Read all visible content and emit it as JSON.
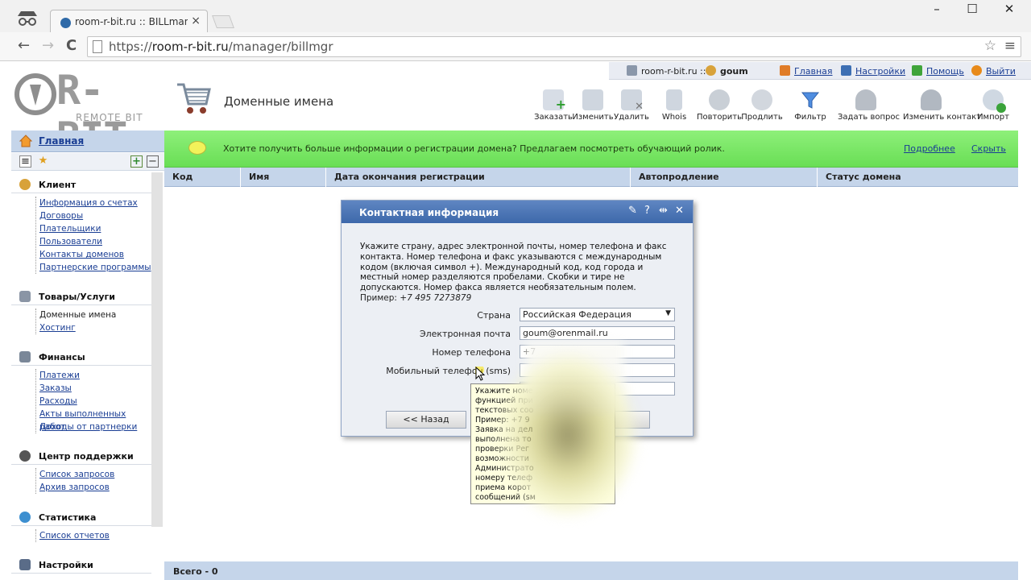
{
  "browser": {
    "tab_title": "room-r-bit.ru :: BILLmanag",
    "tab_close": "×",
    "url_prefix": "https://",
    "url_host": "room-r-bit.ru",
    "url_path": "/manager/billmgr",
    "window_minimize": "–",
    "window_maximize": "☐",
    "window_close": "✕",
    "back": "←",
    "forward": "→",
    "reload": "C",
    "star": "☆",
    "menu": "≡"
  },
  "header": {
    "logo_text": "R-BIT",
    "logo_sub": "REMOTE BIT",
    "page_title": "Доменные имена",
    "userbar": {
      "site": "room-r-bit.ru ::",
      "user": "goum",
      "home": "Главная",
      "settings": "Настройки",
      "help": "Помощь",
      "logout": "Выйти"
    },
    "toolbar": [
      {
        "label": "Заказать",
        "icon": "add-icon"
      },
      {
        "label": "Изменить",
        "icon": "edit-icon"
      },
      {
        "label": "Удалить",
        "icon": "delete-icon"
      },
      {
        "label": "Whois",
        "icon": "whois-icon"
      },
      {
        "label": "Повторить",
        "icon": "repeat-icon"
      },
      {
        "label": "Продлить",
        "icon": "renew-icon"
      },
      {
        "label": "Фильтр",
        "icon": "filter-icon"
      },
      {
        "label": "Задать вопрос",
        "icon": "question-icon"
      },
      {
        "label": "Изменить контакт",
        "icon": "contact-icon"
      },
      {
        "label": "Импорт",
        "icon": "import-icon"
      }
    ]
  },
  "sidebar": {
    "home": "Главная",
    "tool_plus": "+",
    "tool_minus": "−",
    "sections": [
      {
        "title": "Клиент",
        "items": [
          "Информация о счетах",
          "Договоры",
          "Плательщики",
          "Пользователи",
          "Контакты доменов",
          "Партнерские программы"
        ]
      },
      {
        "title": "Товары/Услуги",
        "items": [
          "Доменные имена",
          "Хостинг"
        ]
      },
      {
        "title": "Финансы",
        "items": [
          "Платежи",
          "Заказы",
          "Расходы",
          "Акты выполненных работ",
          "Доходы от партнерки"
        ]
      },
      {
        "title": "Центр поддержки",
        "items": [
          "Список запросов",
          "Архив запросов"
        ]
      },
      {
        "title": "Статистика",
        "items": [
          "Список отчетов"
        ]
      },
      {
        "title": "Настройки",
        "items": []
      }
    ]
  },
  "banner": {
    "message": "Хотите получить больше информации о регистрации домена? Предлагаем посмотреть обучающий ролик.",
    "more": "Подробнее",
    "hide": "Скрыть"
  },
  "table": {
    "columns": [
      "Код",
      "Имя",
      "Дата окончания регистрации",
      "Автопродление",
      "Статус домена"
    ],
    "footer": "Всего - 0"
  },
  "dialog": {
    "title": "Контактная информация",
    "intro": "Укажите страну, адрес электронной почты, номер телефона и факс контакта. Номер телефона и факс указываются с международным кодом (включая символ +). Международный код, код города и местный номер разделяются пробелами. Скобки и тире не допускаются. Номер факса является необязательным полем.",
    "example_label": "Пример:",
    "example_value": "+7 495 7273879",
    "fields": {
      "country_label": "Страна",
      "country_value": "Российская Федерация",
      "email_label": "Электронная почта",
      "email_value": "goum@orenmail.ru",
      "phone_label": "Номер телефона",
      "phone_value": "+7",
      "mobile_label": "Мобильный телефон (sms)",
      "fax_label": "Но"
    },
    "back_button": "<< Назад"
  },
  "tooltip": {
    "lines": [
      "Укажите номе",
      "функцией при",
      "текстовых соо",
      "Пример: +7 9",
      "Заявка на дел",
      "выполнена то",
      "проверки Рег",
      "возможности",
      "Администрато",
      "номеру телеф",
      "приема корот",
      "сообщений (sм"
    ]
  }
}
